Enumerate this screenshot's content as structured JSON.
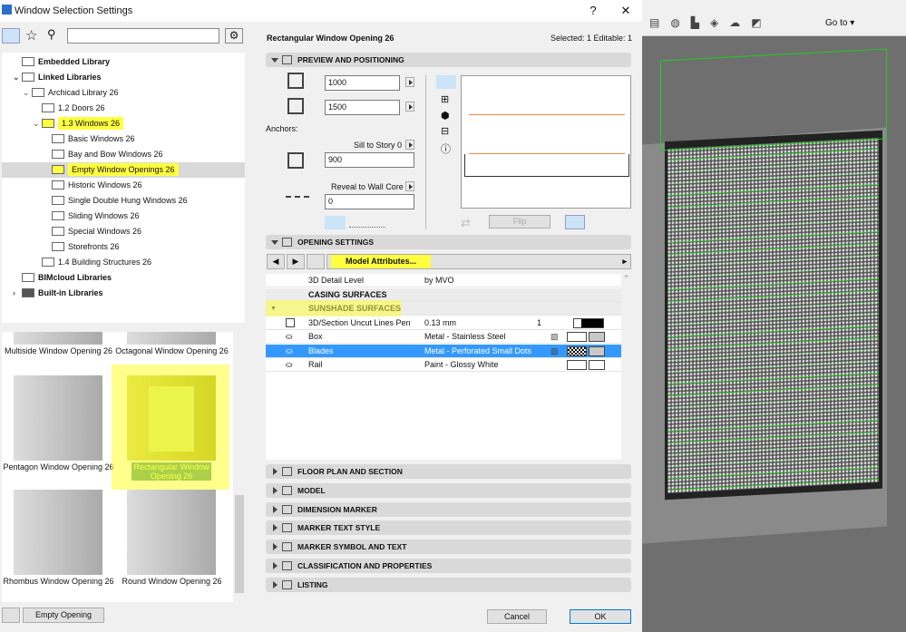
{
  "window": {
    "title": "Window Selection Settings",
    "help": "?",
    "close": "✕"
  },
  "left": {
    "search_value": "",
    "tree": [
      {
        "label": "Embedded Library",
        "bold": true,
        "indent": 0
      },
      {
        "label": "Linked Libraries",
        "bold": true,
        "indent": 0,
        "expanded": true
      },
      {
        "label": "Archicad Library 26",
        "indent": 1,
        "expanded": true
      },
      {
        "label": "1.2 Doors 26",
        "indent": 2
      },
      {
        "label": "1.3 Windows 26",
        "indent": 2,
        "expanded": true,
        "highlight": true
      },
      {
        "label": "Basic Windows 26",
        "indent": 3
      },
      {
        "label": "Bay and Bow Windows 26",
        "indent": 3
      },
      {
        "label": "Empty Window Openings 26",
        "indent": 3,
        "selected": true,
        "highlight": true
      },
      {
        "label": "Historic Windows 26",
        "indent": 3
      },
      {
        "label": "Single Double Hung Windows 26",
        "indent": 3
      },
      {
        "label": "Sliding Windows 26",
        "indent": 3
      },
      {
        "label": "Special Windows 26",
        "indent": 3
      },
      {
        "label": "Storefronts 26",
        "indent": 3
      },
      {
        "label": "1.4 Building Structures 26",
        "indent": 2
      },
      {
        "label": "BIMcloud Libraries",
        "bold": true,
        "indent": 0
      },
      {
        "label": "Built-in Libraries",
        "bold": true,
        "indent": 0,
        "collapsed": true
      }
    ],
    "thumbs": [
      "Multiside Window Opening 26",
      "Octagonal Window Opening 26",
      "Pentagon Window Opening 26",
      "Rectangular Window Opening 26",
      "Rhombus Window Opening 26",
      "Round Window Opening 26"
    ],
    "empty_opening": "Empty Opening"
  },
  "header": {
    "title": "Rectangular Window Opening 26",
    "status": "Selected: 1 Editable: 1"
  },
  "preview": {
    "section": "PREVIEW AND POSITIONING",
    "width": "1000",
    "height": "1500",
    "anchors": "Anchors:",
    "sill_label": "Sill to Story 0",
    "sill": "900",
    "reveal_label": "Reveal to Wall Core",
    "reveal": "0",
    "flip": "Flip"
  },
  "opening": {
    "section": "OPENING SETTINGS",
    "page": "Model Attributes...",
    "rows": [
      {
        "name": "3D Detail Level",
        "value": "by MVO"
      },
      {
        "name": "CASING SURFACES",
        "group": true
      },
      {
        "name": "SUNSHADE SURFACES",
        "group": true
      },
      {
        "name": "3D/Section Uncut Lines Pen",
        "value": "0.13 mm",
        "num": "1"
      },
      {
        "name": "Box",
        "value": "Metal - Stainless Steel"
      },
      {
        "name": "Blades",
        "value": "Metal - Perforated Small Dots",
        "selected": true
      },
      {
        "name": "Rail",
        "value": "Paint - Glossy White"
      }
    ]
  },
  "sections": [
    "FLOOR PLAN AND SECTION",
    "MODEL",
    "DIMENSION MARKER",
    "MARKER TEXT STYLE",
    "MARKER SYMBOL AND TEXT",
    "CLASSIFICATION AND PROPERTIES",
    "LISTING"
  ],
  "footer": {
    "cancel": "Cancel",
    "ok": "OK"
  },
  "viewport": {
    "goto": "Go to"
  },
  "colors": {
    "highlight": "#ffff40",
    "selection": "#3399ff",
    "mesh": "#22cc22"
  }
}
